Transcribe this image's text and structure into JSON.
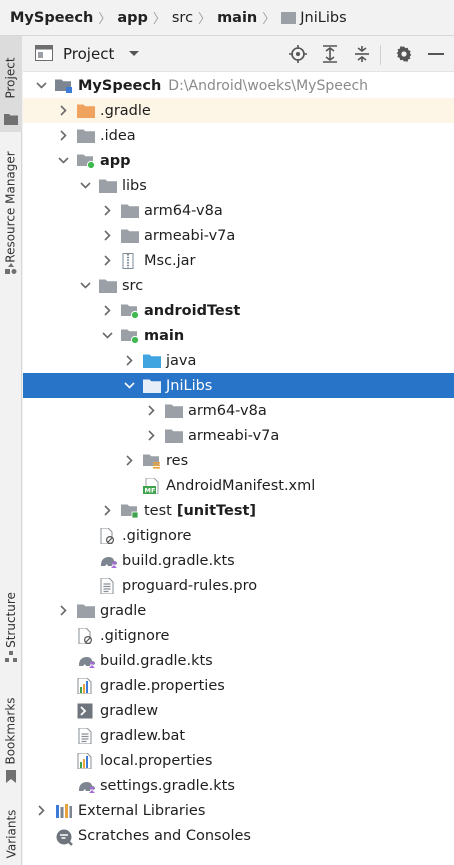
{
  "breadcrumb": {
    "items": [
      {
        "label": "MySpeech",
        "bold": true
      },
      {
        "label": "app",
        "bold": true
      },
      {
        "label": "src",
        "bold": false
      },
      {
        "label": "main",
        "bold": true
      },
      {
        "label": "JniLibs",
        "bold": false
      }
    ]
  },
  "side_tabs": {
    "project": "Project",
    "resource_manager": "Resource Manager",
    "structure": "Structure",
    "bookmarks": "Bookmarks",
    "variants": "Variants"
  },
  "toolbar": {
    "title": "Project",
    "icons": [
      "locate-icon",
      "expand-all-icon",
      "collapse-all-icon",
      "settings-icon",
      "hide-icon"
    ]
  },
  "tree": [
    {
      "label": "MySpeech",
      "path": "D:\\Android\\woeks\\MySpeech",
      "bold": true,
      "level": 0,
      "chev": "down",
      "icon": "module-icon"
    },
    {
      "label": ".gradle",
      "level": 1,
      "chev": "right",
      "icon": "folder-orange-icon",
      "highlight": true
    },
    {
      "label": ".idea",
      "level": 1,
      "chev": "right",
      "icon": "folder-icon"
    },
    {
      "label": "app",
      "bold": true,
      "level": 1,
      "chev": "down",
      "icon": "module-app-icon"
    },
    {
      "label": "libs",
      "level": 2,
      "chev": "down",
      "icon": "folder-icon"
    },
    {
      "label": "arm64-v8a",
      "level": 3,
      "chev": "right",
      "icon": "folder-icon"
    },
    {
      "label": "armeabi-v7a",
      "level": 3,
      "chev": "right",
      "icon": "folder-icon"
    },
    {
      "label": "Msc.jar",
      "level": 3,
      "chev": "right",
      "icon": "jar-icon"
    },
    {
      "label": "src",
      "level": 2,
      "chev": "down",
      "icon": "folder-icon"
    },
    {
      "label": "androidTest",
      "bold": true,
      "level": 3,
      "chev": "right",
      "icon": "folder-dot-icon"
    },
    {
      "label": "main",
      "bold": true,
      "level": 3,
      "chev": "down",
      "icon": "folder-dot-icon"
    },
    {
      "label": "java",
      "level": 4,
      "chev": "right",
      "icon": "folder-blue-icon"
    },
    {
      "label": "JniLibs",
      "level": 4,
      "chev": "down",
      "icon": "folder-icon",
      "selected": true
    },
    {
      "label": "arm64-v8a",
      "level": 5,
      "chev": "right",
      "icon": "folder-icon"
    },
    {
      "label": "armeabi-v7a",
      "level": 5,
      "chev": "right",
      "icon": "folder-icon"
    },
    {
      "label": "res",
      "level": 4,
      "chev": "right",
      "icon": "folder-res-icon"
    },
    {
      "label": "AndroidManifest.xml",
      "level": 4,
      "chev": "none",
      "icon": "manifest-icon"
    },
    {
      "label": "test",
      "suffix": "[unitTest]",
      "level": 3,
      "chev": "right",
      "icon": "folder-test-icon"
    },
    {
      "label": ".gitignore",
      "level": 2,
      "chev": "none",
      "icon": "gitignore-icon"
    },
    {
      "label": "build.gradle.kts",
      "level": 2,
      "chev": "none",
      "icon": "gradle-kts-icon"
    },
    {
      "label": "proguard-rules.pro",
      "level": 2,
      "chev": "none",
      "icon": "text-file-icon"
    },
    {
      "label": "gradle",
      "level": 1,
      "chev": "right",
      "icon": "folder-icon"
    },
    {
      "label": ".gitignore",
      "level": 1,
      "chev": "none",
      "icon": "gitignore-icon"
    },
    {
      "label": "build.gradle.kts",
      "level": 1,
      "chev": "none",
      "icon": "gradle-kts-icon"
    },
    {
      "label": "gradle.properties",
      "level": 1,
      "chev": "none",
      "icon": "properties-icon"
    },
    {
      "label": "gradlew",
      "level": 1,
      "chev": "none",
      "icon": "shell-icon"
    },
    {
      "label": "gradlew.bat",
      "level": 1,
      "chev": "none",
      "icon": "text-file-icon"
    },
    {
      "label": "local.properties",
      "level": 1,
      "chev": "none",
      "icon": "properties-icon"
    },
    {
      "label": "settings.gradle.kts",
      "level": 1,
      "chev": "none",
      "icon": "gradle-kts-icon"
    },
    {
      "label": "External Libraries",
      "level": 0,
      "chev": "right",
      "icon": "libraries-icon"
    },
    {
      "label": "Scratches and Consoles",
      "level": 0,
      "chev": "none",
      "icon": "scratches-icon"
    }
  ],
  "colors": {
    "selection": "#2874c8",
    "folder": "#9aa0a6",
    "folder_orange": "#f0a35e",
    "folder_blue": "#40a4e0",
    "dot_green": "#3fb950",
    "highlight_row": "#fdf6e6"
  }
}
